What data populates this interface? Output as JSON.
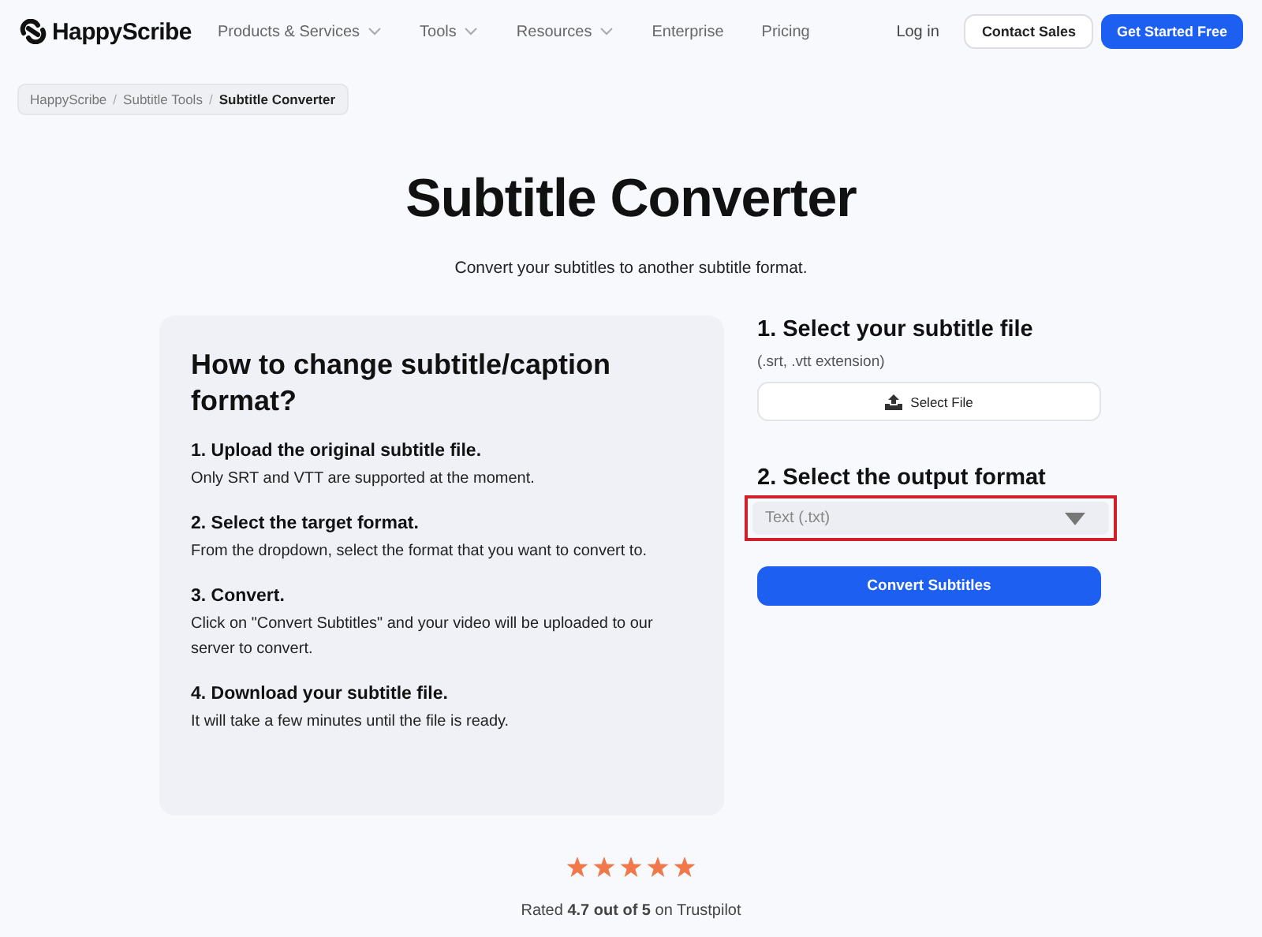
{
  "header": {
    "logo": "HappyScribe",
    "nav": [
      {
        "label": "Products & Services",
        "has_menu": true
      },
      {
        "label": "Tools",
        "has_menu": true
      },
      {
        "label": "Resources",
        "has_menu": true
      },
      {
        "label": "Enterprise",
        "has_menu": false
      },
      {
        "label": "Pricing",
        "has_menu": false
      }
    ],
    "login": "Log in",
    "contact_button": "Contact Sales",
    "cta_button": "Get Started Free"
  },
  "breadcrumb_separator": "/",
  "breadcrumb": [
    {
      "label": "HappyScribe",
      "selected": false
    },
    {
      "label": "Subtitle Tools",
      "selected": false
    },
    {
      "label": "Subtitle Converter",
      "selected": true
    }
  ],
  "title": "Subtitle Converter",
  "subtitle": "Convert your subtitles to another subtitle format.",
  "howto": {
    "heading": "How to change subtitle/caption format?",
    "steps": [
      {
        "title": "1. Upload the original subtitle file.",
        "text": "Only SRT and VTT are supported at the moment."
      },
      {
        "title": "2. Select the target format.",
        "text": "From the dropdown, select the format that you want to convert to."
      },
      {
        "title": "3. Convert.",
        "text": "Click on \"Convert Subtitles\" and your video will be uploaded to our server to convert."
      },
      {
        "title": "4. Download your subtitle file.",
        "text": "It will take a few minutes until the file is ready."
      }
    ]
  },
  "converter": {
    "step1_title": "1.  Select your subtitle file",
    "step1_hint": "(.srt, .vtt extension)",
    "select_button": "Select File",
    "step2_title": "2.  Select the output format",
    "format_dropdown": {
      "value": "Text (.txt)",
      "highlighted": true
    },
    "convert_button": "Convert Subtitles"
  },
  "rating": {
    "stars": 5,
    "text": "Rated **4.7 out of 5** on Trustpilot"
  }
}
